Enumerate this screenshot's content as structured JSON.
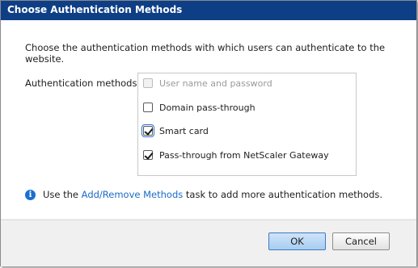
{
  "dialog": {
    "title": "Choose Authentication Methods",
    "description": "Choose the authentication methods with which users can authenticate to the website.",
    "methods_label": "Authentication methods:",
    "methods": [
      {
        "label": "User name and password",
        "checked": false,
        "disabled": true
      },
      {
        "label": "Domain pass-through",
        "checked": false,
        "disabled": false
      },
      {
        "label": "Smart card",
        "checked": true,
        "disabled": false,
        "focused": true
      },
      {
        "label": "Pass-through from NetScaler Gateway",
        "checked": true,
        "disabled": false
      }
    ],
    "info": {
      "icon": "info-icon",
      "prefix": "Use the ",
      "link": "Add/Remove Methods",
      "suffix": " task to add more authentication methods."
    },
    "buttons": {
      "ok": "OK",
      "cancel": "Cancel"
    }
  },
  "colors": {
    "titlebar": "#0e3f86",
    "link": "#1a6ac7",
    "info_icon": "#1b6fd1"
  }
}
